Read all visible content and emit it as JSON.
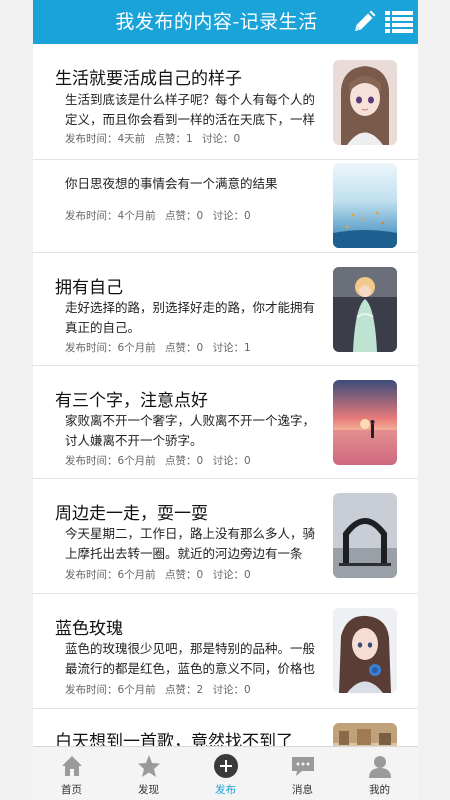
{
  "header": {
    "title": "我发布的内容-记录生活",
    "edit_icon": "pencil-icon",
    "list_icon": "list-icon",
    "accent_color": "#1aa3d9"
  },
  "posts": [
    {
      "title": "生活就要活成自己的样子",
      "excerpt": "生活到底该是什么样子呢？每个人有每个人的定义，而且你会看到一样的活在天底下，一样",
      "time_label": "发布时间：4天前",
      "likes_label": "点赞：1",
      "comments_label": "讨论：0",
      "thumb": "anime-girl-portrait"
    },
    {
      "title": "",
      "excerpt": "你日思夜想的事情会有一个满意的结果",
      "time_label": "发布时间：4个月前",
      "likes_label": "点赞：0",
      "comments_label": "讨论：0",
      "thumb": "water-scene"
    },
    {
      "title": "拥有自己",
      "excerpt": "走好选择的路，别选择好走的路，你才能拥有真正的自己。",
      "time_label": "发布时间：6个月前",
      "likes_label": "点赞：0",
      "comments_label": "讨论：1",
      "thumb": "princess-figurine"
    },
    {
      "title": "有三个字，注意点好",
      "excerpt": "家败离不开一个奢字，人败离不开一个逸字，讨人嫌离不开一个骄字。",
      "time_label": "发布时间：6个月前",
      "likes_label": "点赞：0",
      "comments_label": "讨论：0",
      "thumb": "sunset-beach"
    },
    {
      "title": "周边走一走，耍一耍",
      "excerpt": "今天星期二，工作日，路上没有那么多人，骑上摩托出去转一圈。就近的河边旁边有一条",
      "time_label": "发布时间：6个月前",
      "likes_label": "点赞：0",
      "comments_label": "讨论：0",
      "thumb": "arch-sculpture"
    },
    {
      "title": "蓝色玫瑰",
      "excerpt": "蓝色的玫瑰很少见吧，那是特别的品种。一般最流行的都是红色，蓝色的意义不同，价格也",
      "time_label": "发布时间：6个月前",
      "likes_label": "点赞：2",
      "comments_label": "讨论：0",
      "thumb": "girl-blue-rose"
    },
    {
      "title": "白天想到一首歌，竟然找不到了",
      "excerpt": "",
      "time_label": "",
      "likes_label": "",
      "comments_label": "",
      "thumb": "street-scene"
    }
  ],
  "nav": [
    {
      "label": "首页",
      "icon": "home-icon",
      "active": false
    },
    {
      "label": "发现",
      "icon": "star-icon",
      "active": false
    },
    {
      "label": "发布",
      "icon": "plus-circle-icon",
      "active": true
    },
    {
      "label": "消息",
      "icon": "message-icon",
      "active": false
    },
    {
      "label": "我的",
      "icon": "user-icon",
      "active": false
    }
  ]
}
